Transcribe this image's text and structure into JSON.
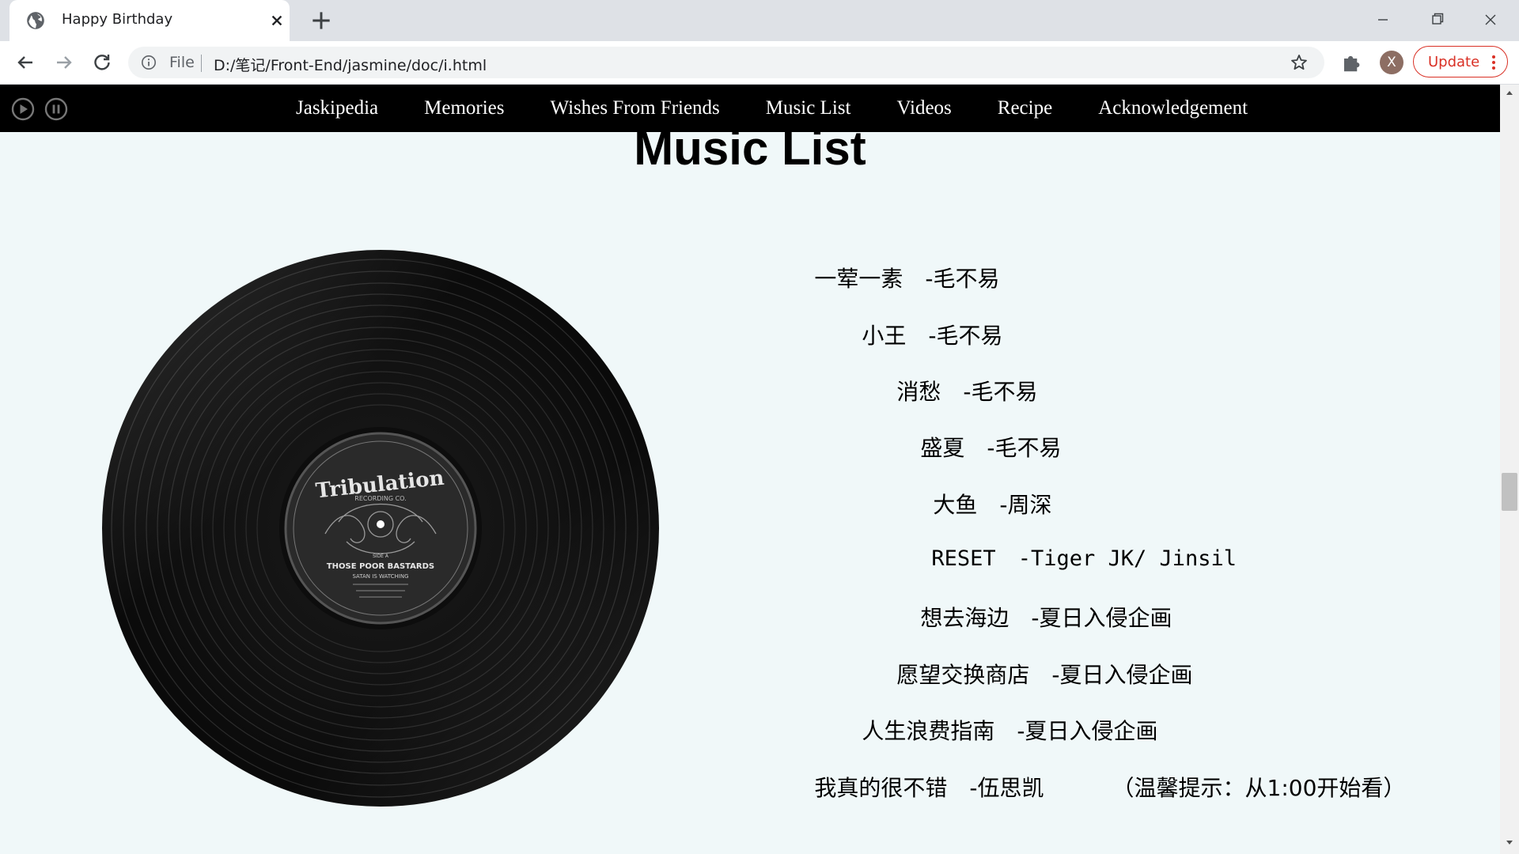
{
  "browser": {
    "tab_title": "Happy Birthday",
    "scheme_label": "File",
    "url": "D:/笔记/Front-End/jasmine/doc/i.html",
    "avatar_letter": "X",
    "update_label": "Update"
  },
  "page": {
    "hidden_heading": "Music List",
    "nav": [
      "Jaskipedia",
      "Memories",
      "Wishes From Friends",
      "Music List",
      "Videos",
      "Recipe",
      "Acknowledgement"
    ],
    "record_label": {
      "brand": "Tribulation",
      "sub": "RECORDING CO.",
      "side": "SIDE A",
      "album": "THOSE POOR BASTARDS",
      "subtitle": "SATAN IS WATCHING"
    },
    "songs": [
      {
        "name": "一荤一素",
        "artist": "-毛不易"
      },
      {
        "name": "小王",
        "artist": "-毛不易"
      },
      {
        "name": "消愁",
        "artist": "-毛不易"
      },
      {
        "name": "盛夏",
        "artist": "-毛不易"
      },
      {
        "name": "大鱼",
        "artist": "-周深"
      },
      {
        "name": "RESET",
        "artist": "-Tiger JK/ Jinsil"
      },
      {
        "name": "想去海边",
        "artist": "-夏日入侵企画"
      },
      {
        "name": "愿望交换商店",
        "artist": "-夏日入侵企画"
      },
      {
        "name": "人生浪费指南",
        "artist": "-夏日入侵企画"
      },
      {
        "name": "我真的很不错",
        "artist": "-伍思凯",
        "tip": "（温馨提示：从1:00开始看）"
      }
    ]
  }
}
